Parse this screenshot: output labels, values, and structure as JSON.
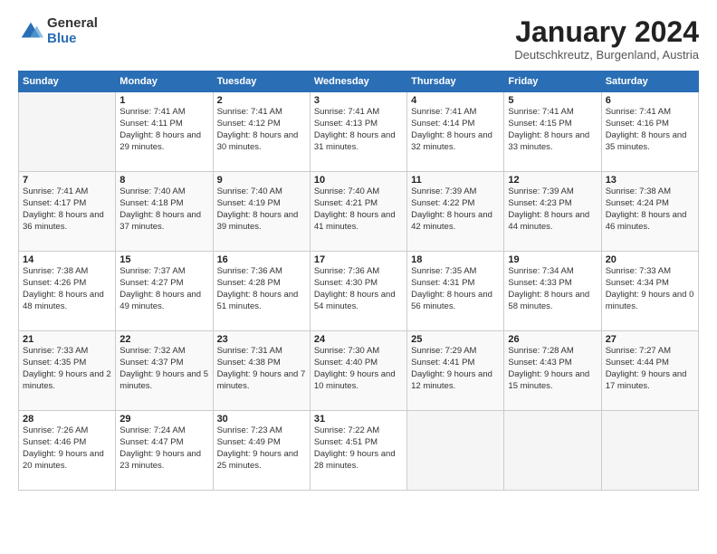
{
  "logo": {
    "general": "General",
    "blue": "Blue"
  },
  "header": {
    "month": "January 2024",
    "location": "Deutschkreutz, Burgenland, Austria"
  },
  "weekdays": [
    "Sunday",
    "Monday",
    "Tuesday",
    "Wednesday",
    "Thursday",
    "Friday",
    "Saturday"
  ],
  "weeks": [
    [
      {
        "day": "",
        "empty": true
      },
      {
        "day": "1",
        "sunrise": "7:41 AM",
        "sunset": "4:11 PM",
        "daylight": "8 hours and 29 minutes."
      },
      {
        "day": "2",
        "sunrise": "7:41 AM",
        "sunset": "4:12 PM",
        "daylight": "8 hours and 30 minutes."
      },
      {
        "day": "3",
        "sunrise": "7:41 AM",
        "sunset": "4:13 PM",
        "daylight": "8 hours and 31 minutes."
      },
      {
        "day": "4",
        "sunrise": "7:41 AM",
        "sunset": "4:14 PM",
        "daylight": "8 hours and 32 minutes."
      },
      {
        "day": "5",
        "sunrise": "7:41 AM",
        "sunset": "4:15 PM",
        "daylight": "8 hours and 33 minutes."
      },
      {
        "day": "6",
        "sunrise": "7:41 AM",
        "sunset": "4:16 PM",
        "daylight": "8 hours and 35 minutes."
      }
    ],
    [
      {
        "day": "7",
        "sunrise": "7:41 AM",
        "sunset": "4:17 PM",
        "daylight": "8 hours and 36 minutes."
      },
      {
        "day": "8",
        "sunrise": "7:40 AM",
        "sunset": "4:18 PM",
        "daylight": "8 hours and 37 minutes."
      },
      {
        "day": "9",
        "sunrise": "7:40 AM",
        "sunset": "4:19 PM",
        "daylight": "8 hours and 39 minutes."
      },
      {
        "day": "10",
        "sunrise": "7:40 AM",
        "sunset": "4:21 PM",
        "daylight": "8 hours and 41 minutes."
      },
      {
        "day": "11",
        "sunrise": "7:39 AM",
        "sunset": "4:22 PM",
        "daylight": "8 hours and 42 minutes."
      },
      {
        "day": "12",
        "sunrise": "7:39 AM",
        "sunset": "4:23 PM",
        "daylight": "8 hours and 44 minutes."
      },
      {
        "day": "13",
        "sunrise": "7:38 AM",
        "sunset": "4:24 PM",
        "daylight": "8 hours and 46 minutes."
      }
    ],
    [
      {
        "day": "14",
        "sunrise": "7:38 AM",
        "sunset": "4:26 PM",
        "daylight": "8 hours and 48 minutes."
      },
      {
        "day": "15",
        "sunrise": "7:37 AM",
        "sunset": "4:27 PM",
        "daylight": "8 hours and 49 minutes."
      },
      {
        "day": "16",
        "sunrise": "7:36 AM",
        "sunset": "4:28 PM",
        "daylight": "8 hours and 51 minutes."
      },
      {
        "day": "17",
        "sunrise": "7:36 AM",
        "sunset": "4:30 PM",
        "daylight": "8 hours and 54 minutes."
      },
      {
        "day": "18",
        "sunrise": "7:35 AM",
        "sunset": "4:31 PM",
        "daylight": "8 hours and 56 minutes."
      },
      {
        "day": "19",
        "sunrise": "7:34 AM",
        "sunset": "4:33 PM",
        "daylight": "8 hours and 58 minutes."
      },
      {
        "day": "20",
        "sunrise": "7:33 AM",
        "sunset": "4:34 PM",
        "daylight": "9 hours and 0 minutes."
      }
    ],
    [
      {
        "day": "21",
        "sunrise": "7:33 AM",
        "sunset": "4:35 PM",
        "daylight": "9 hours and 2 minutes."
      },
      {
        "day": "22",
        "sunrise": "7:32 AM",
        "sunset": "4:37 PM",
        "daylight": "9 hours and 5 minutes."
      },
      {
        "day": "23",
        "sunrise": "7:31 AM",
        "sunset": "4:38 PM",
        "daylight": "9 hours and 7 minutes."
      },
      {
        "day": "24",
        "sunrise": "7:30 AM",
        "sunset": "4:40 PM",
        "daylight": "9 hours and 10 minutes."
      },
      {
        "day": "25",
        "sunrise": "7:29 AM",
        "sunset": "4:41 PM",
        "daylight": "9 hours and 12 minutes."
      },
      {
        "day": "26",
        "sunrise": "7:28 AM",
        "sunset": "4:43 PM",
        "daylight": "9 hours and 15 minutes."
      },
      {
        "day": "27",
        "sunrise": "7:27 AM",
        "sunset": "4:44 PM",
        "daylight": "9 hours and 17 minutes."
      }
    ],
    [
      {
        "day": "28",
        "sunrise": "7:26 AM",
        "sunset": "4:46 PM",
        "daylight": "9 hours and 20 minutes."
      },
      {
        "day": "29",
        "sunrise": "7:24 AM",
        "sunset": "4:47 PM",
        "daylight": "9 hours and 23 minutes."
      },
      {
        "day": "30",
        "sunrise": "7:23 AM",
        "sunset": "4:49 PM",
        "daylight": "9 hours and 25 minutes."
      },
      {
        "day": "31",
        "sunrise": "7:22 AM",
        "sunset": "4:51 PM",
        "daylight": "9 hours and 28 minutes."
      },
      {
        "day": "",
        "empty": true
      },
      {
        "day": "",
        "empty": true
      },
      {
        "day": "",
        "empty": true
      }
    ]
  ]
}
